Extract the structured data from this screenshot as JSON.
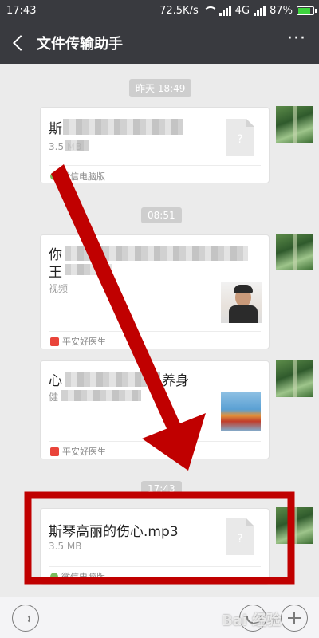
{
  "status": {
    "time": "17:43",
    "speed": "72.5K/s",
    "network": "4G",
    "battery": "87%",
    "battery_level": 0.87
  },
  "header": {
    "title": "文件传输助手",
    "more": "···"
  },
  "chips": {
    "yesterday": "昨天 18:49",
    "morning": "08:51",
    "now": "17:43"
  },
  "messages": {
    "file1": {
      "title_first": "斯",
      "size": "3.5 MB",
      "source": "微信电脑版"
    },
    "article1": {
      "title_first": "你",
      "title_line2": "王",
      "sub": "视频",
      "source": "平安好医生"
    },
    "article2": {
      "title_first": "心",
      "title_end": "养身",
      "sub": "健",
      "source": "平安好医生"
    },
    "file2": {
      "title": "斯琴高丽的伤心.mp3",
      "size": "3.5 MB",
      "source": "微信电脑版"
    }
  },
  "fileicon": {
    "glyph": "?"
  },
  "watermark": "Bai 经验",
  "colors": {
    "header": "#393a3f",
    "annotation": "#c00000",
    "wechat_green": "#7bbb5e",
    "pingan_red": "#e9443a"
  }
}
